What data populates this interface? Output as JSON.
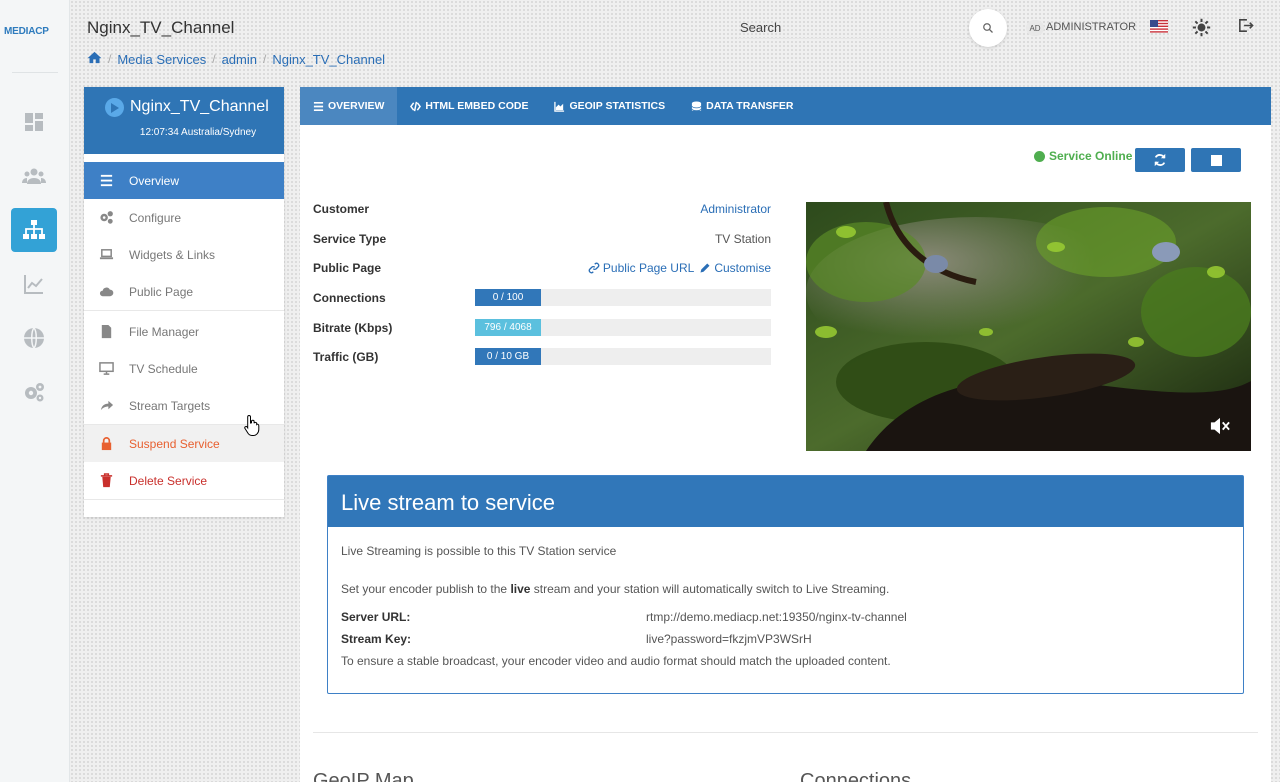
{
  "app": {
    "logo": "MEDIACP",
    "window_title": "Nginx_TV_Channel"
  },
  "breadcrumb": {
    "items": [
      "Media Services",
      "admin"
    ],
    "current": "Nginx_TV_Channel"
  },
  "header": {
    "search_label": "Search",
    "avatar_initials": "AD",
    "user_name": "ADMINISTRATOR",
    "language_flag": "us-flag-icon"
  },
  "rail": {
    "icons": [
      "dashboard-icon",
      "users-icon",
      "sitemap-icon",
      "chart-line-icon",
      "globe-icon",
      "settings-icon"
    ],
    "active_index": 2
  },
  "service_card": {
    "name": "Nginx_TV_Channel",
    "time": "12:07:34 Australia/Sydney",
    "menu": [
      {
        "label": "Overview",
        "icon": "list-icon",
        "state": "active"
      },
      {
        "label": "Configure",
        "icon": "cogs-icon"
      },
      {
        "label": "Widgets & Links",
        "icon": "laptop-icon"
      },
      {
        "label": "Public Page",
        "icon": "cloud-icon"
      },
      {
        "label": "File Manager",
        "icon": "file-icon"
      },
      {
        "label": "TV Schedule",
        "icon": "monitor-icon"
      },
      {
        "label": "Stream Targets",
        "icon": "share-icon"
      },
      {
        "label": "Suspend Service",
        "icon": "lock-icon",
        "state": "hover"
      },
      {
        "label": "Delete Service",
        "icon": "trash-icon"
      }
    ]
  },
  "tabs": [
    {
      "label": "OVERVIEW",
      "icon": "list-icon",
      "active": true
    },
    {
      "label": "HTML EMBED CODE",
      "icon": "code-icon"
    },
    {
      "label": "GEOIP STATISTICS",
      "icon": "area-chart-icon"
    },
    {
      "label": "DATA TRANSFER",
      "icon": "database-icon"
    }
  ],
  "status": {
    "text": "Service Online",
    "color": "#4fae4f"
  },
  "overview": {
    "customer_label": "Customer",
    "customer_value": "Administrator",
    "service_type_label": "Service Type",
    "service_type_value": "TV Station",
    "public_page_label": "Public Page",
    "public_page_url": "Public Page URL",
    "customise": "Customise",
    "connections_label": "Connections",
    "connections_text": "0 / 100",
    "connections_fraction": 0,
    "bitrate_label": "Bitrate (Kbps)",
    "bitrate_text": "796 / 4068",
    "bitrate_fraction": 0.196,
    "traffic_label": "Traffic (GB)",
    "traffic_text": "0 / 10 GB",
    "traffic_fraction": 0
  },
  "live": {
    "title": "Live stream to service",
    "line1": "Live Streaming is possible to this TV Station service",
    "line2_pre": "Set your encoder publish to the ",
    "line2_bold": "live",
    "line2_post": " stream and your station will automatically switch to Live Streaming.",
    "server_url_label": "Server URL:",
    "server_url": "rtmp://demo.mediacp.net:19350/nginx-tv-channel",
    "stream_key_label": "Stream Key:",
    "stream_key": "live?password=fkzjmVP3WSrH",
    "note": "To ensure a stable broadcast, your encoder video and audio format should match the uploaded content."
  },
  "sections": {
    "geoip": "GeoIP Map",
    "connections": "Connections"
  },
  "colors": {
    "primary": "#2f75b5",
    "rail_active": "#33a2d6",
    "danger": "#c9302c",
    "bitrate_bar": "#5bc0de"
  }
}
